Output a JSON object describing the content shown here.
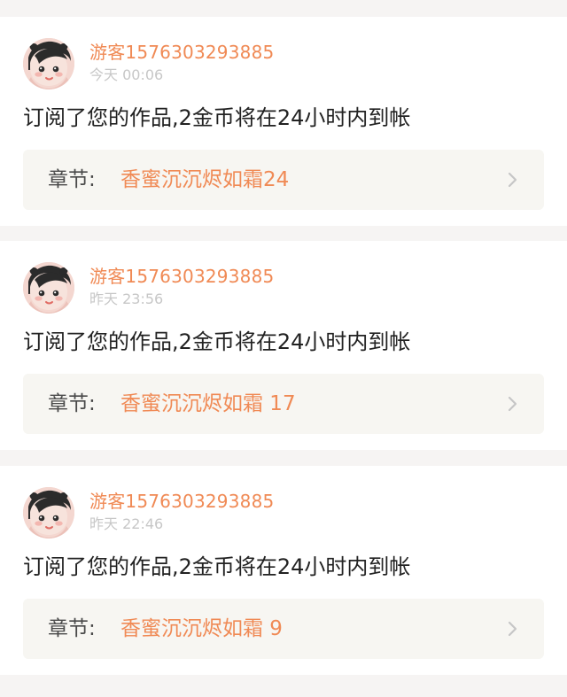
{
  "feed": {
    "items": [
      {
        "username": "游客1576303293885",
        "timestamp": "今天 00:06",
        "message": "订阅了您的作品,2金币将在24小时内到帐",
        "chapter_label": "章节:",
        "chapter_title": "香蜜沉沉烬如霜24"
      },
      {
        "username": "游客1576303293885",
        "timestamp": "昨天 23:56",
        "message": "订阅了您的作品,2金币将在24小时内到帐",
        "chapter_label": "章节:",
        "chapter_title": "香蜜沉沉烬如霜 17"
      },
      {
        "username": "游客1576303293885",
        "timestamp": "昨天 22:46",
        "message": "订阅了您的作品,2金币将在24小时内到帐",
        "chapter_label": "章节:",
        "chapter_title": "香蜜沉沉烬如霜 9"
      }
    ]
  },
  "colors": {
    "accent": "#f08a55",
    "background": "#f6f4f3",
    "card": "#ffffff",
    "chapter_bg": "#f7f6f2",
    "text": "#222222",
    "muted": "#c7c7c7"
  },
  "icons": {
    "avatar": "cartoon-girl-avatar",
    "chevron": "chevron-right-icon"
  }
}
